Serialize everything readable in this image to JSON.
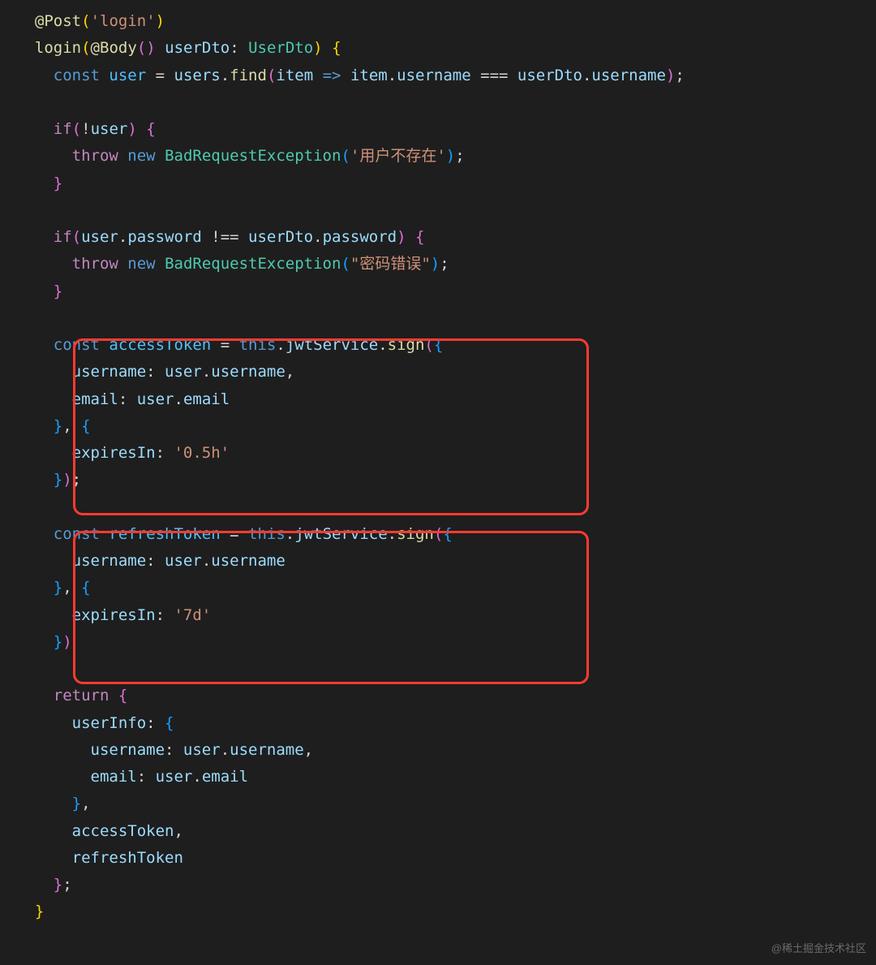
{
  "code": {
    "lines": [
      {
        "tokens": [
          {
            "t": "  ",
            "c": "punct"
          },
          {
            "t": "@",
            "c": "decorator"
          },
          {
            "t": "Post",
            "c": "function"
          },
          {
            "t": "(",
            "c": "bracket-yellow"
          },
          {
            "t": "'login'",
            "c": "string"
          },
          {
            "t": ")",
            "c": "bracket-yellow"
          }
        ]
      },
      {
        "tokens": [
          {
            "t": "  ",
            "c": "punct"
          },
          {
            "t": "login",
            "c": "function"
          },
          {
            "t": "(",
            "c": "bracket-yellow"
          },
          {
            "t": "@",
            "c": "decorator"
          },
          {
            "t": "Body",
            "c": "function"
          },
          {
            "t": "(",
            "c": "bracket-pink"
          },
          {
            "t": ")",
            "c": "bracket-pink"
          },
          {
            "t": " ",
            "c": "punct"
          },
          {
            "t": "userDto",
            "c": "param"
          },
          {
            "t": ": ",
            "c": "punct"
          },
          {
            "t": "UserDto",
            "c": "type"
          },
          {
            "t": ")",
            "c": "bracket-yellow"
          },
          {
            "t": " ",
            "c": "punct"
          },
          {
            "t": "{",
            "c": "bracket-yellow"
          }
        ]
      },
      {
        "tokens": [
          {
            "t": "    ",
            "c": "punct"
          },
          {
            "t": "const",
            "c": "keyword-blue"
          },
          {
            "t": " ",
            "c": "punct"
          },
          {
            "t": "user",
            "c": "variable2"
          },
          {
            "t": " = ",
            "c": "operator"
          },
          {
            "t": "users",
            "c": "variable"
          },
          {
            "t": ".",
            "c": "punct"
          },
          {
            "t": "find",
            "c": "function"
          },
          {
            "t": "(",
            "c": "bracket-pink"
          },
          {
            "t": "item",
            "c": "param"
          },
          {
            "t": " ",
            "c": "punct"
          },
          {
            "t": "=>",
            "c": "keyword-blue"
          },
          {
            "t": " ",
            "c": "punct"
          },
          {
            "t": "item",
            "c": "variable"
          },
          {
            "t": ".",
            "c": "punct"
          },
          {
            "t": "username",
            "c": "property"
          },
          {
            "t": " === ",
            "c": "operator"
          },
          {
            "t": "userDto",
            "c": "variable"
          },
          {
            "t": ".",
            "c": "punct"
          },
          {
            "t": "username",
            "c": "property"
          },
          {
            "t": ")",
            "c": "bracket-pink"
          },
          {
            "t": ";",
            "c": "punct"
          }
        ]
      },
      {
        "tokens": [
          {
            "t": " ",
            "c": "punct"
          }
        ]
      },
      {
        "tokens": [
          {
            "t": "    ",
            "c": "punct"
          },
          {
            "t": "if",
            "c": "keyword"
          },
          {
            "t": "(",
            "c": "bracket-pink"
          },
          {
            "t": "!",
            "c": "operator"
          },
          {
            "t": "user",
            "c": "variable"
          },
          {
            "t": ")",
            "c": "bracket-pink"
          },
          {
            "t": " ",
            "c": "punct"
          },
          {
            "t": "{",
            "c": "bracket-pink"
          }
        ]
      },
      {
        "tokens": [
          {
            "t": "      ",
            "c": "punct"
          },
          {
            "t": "throw",
            "c": "keyword"
          },
          {
            "t": " ",
            "c": "punct"
          },
          {
            "t": "new",
            "c": "new"
          },
          {
            "t": " ",
            "c": "punct"
          },
          {
            "t": "BadRequestException",
            "c": "type"
          },
          {
            "t": "(",
            "c": "bracket-blue"
          },
          {
            "t": "'用户不存在'",
            "c": "string"
          },
          {
            "t": ")",
            "c": "bracket-blue"
          },
          {
            "t": ";",
            "c": "punct"
          }
        ]
      },
      {
        "tokens": [
          {
            "t": "    ",
            "c": "punct"
          },
          {
            "t": "}",
            "c": "bracket-pink"
          }
        ]
      },
      {
        "tokens": [
          {
            "t": " ",
            "c": "punct"
          }
        ]
      },
      {
        "tokens": [
          {
            "t": "    ",
            "c": "punct"
          },
          {
            "t": "if",
            "c": "keyword"
          },
          {
            "t": "(",
            "c": "bracket-pink"
          },
          {
            "t": "user",
            "c": "variable"
          },
          {
            "t": ".",
            "c": "punct"
          },
          {
            "t": "password",
            "c": "property"
          },
          {
            "t": " !== ",
            "c": "operator"
          },
          {
            "t": "userDto",
            "c": "variable"
          },
          {
            "t": ".",
            "c": "punct"
          },
          {
            "t": "password",
            "c": "property"
          },
          {
            "t": ")",
            "c": "bracket-pink"
          },
          {
            "t": " ",
            "c": "punct"
          },
          {
            "t": "{",
            "c": "bracket-pink"
          }
        ]
      },
      {
        "tokens": [
          {
            "t": "      ",
            "c": "punct"
          },
          {
            "t": "throw",
            "c": "keyword"
          },
          {
            "t": " ",
            "c": "punct"
          },
          {
            "t": "new",
            "c": "new"
          },
          {
            "t": " ",
            "c": "punct"
          },
          {
            "t": "BadRequestException",
            "c": "type"
          },
          {
            "t": "(",
            "c": "bracket-blue"
          },
          {
            "t": "\"密码错误\"",
            "c": "string"
          },
          {
            "t": ")",
            "c": "bracket-blue"
          },
          {
            "t": ";",
            "c": "punct"
          }
        ]
      },
      {
        "tokens": [
          {
            "t": "    ",
            "c": "punct"
          },
          {
            "t": "}",
            "c": "bracket-pink"
          }
        ]
      },
      {
        "tokens": [
          {
            "t": " ",
            "c": "punct"
          }
        ]
      },
      {
        "tokens": [
          {
            "t": "    ",
            "c": "punct"
          },
          {
            "t": "const",
            "c": "keyword-blue"
          },
          {
            "t": " ",
            "c": "punct"
          },
          {
            "t": "accessToken",
            "c": "variable2"
          },
          {
            "t": " = ",
            "c": "operator"
          },
          {
            "t": "this",
            "c": "this"
          },
          {
            "t": ".",
            "c": "punct"
          },
          {
            "t": "jwtService",
            "c": "property"
          },
          {
            "t": ".",
            "c": "punct"
          },
          {
            "t": "sign",
            "c": "function"
          },
          {
            "t": "(",
            "c": "bracket-pink"
          },
          {
            "t": "{",
            "c": "bracket-blue"
          }
        ]
      },
      {
        "tokens": [
          {
            "t": "      ",
            "c": "punct"
          },
          {
            "t": "username",
            "c": "property"
          },
          {
            "t": ": ",
            "c": "punct"
          },
          {
            "t": "user",
            "c": "variable"
          },
          {
            "t": ".",
            "c": "punct"
          },
          {
            "t": "username",
            "c": "property"
          },
          {
            "t": ",",
            "c": "punct"
          }
        ]
      },
      {
        "tokens": [
          {
            "t": "      ",
            "c": "punct"
          },
          {
            "t": "email",
            "c": "property"
          },
          {
            "t": ": ",
            "c": "punct"
          },
          {
            "t": "user",
            "c": "variable"
          },
          {
            "t": ".",
            "c": "punct"
          },
          {
            "t": "email",
            "c": "property"
          }
        ]
      },
      {
        "tokens": [
          {
            "t": "    ",
            "c": "punct"
          },
          {
            "t": "}",
            "c": "bracket-blue"
          },
          {
            "t": ", ",
            "c": "punct"
          },
          {
            "t": "{",
            "c": "bracket-blue"
          }
        ]
      },
      {
        "tokens": [
          {
            "t": "      ",
            "c": "punct"
          },
          {
            "t": "expiresIn",
            "c": "property"
          },
          {
            "t": ": ",
            "c": "punct"
          },
          {
            "t": "'0.5h'",
            "c": "string"
          }
        ]
      },
      {
        "tokens": [
          {
            "t": "    ",
            "c": "punct"
          },
          {
            "t": "}",
            "c": "bracket-blue"
          },
          {
            "t": ")",
            "c": "bracket-pink"
          },
          {
            "t": ";",
            "c": "punct"
          }
        ]
      },
      {
        "tokens": [
          {
            "t": " ",
            "c": "punct"
          }
        ]
      },
      {
        "tokens": [
          {
            "t": "    ",
            "c": "punct"
          },
          {
            "t": "const",
            "c": "keyword-blue"
          },
          {
            "t": " ",
            "c": "punct"
          },
          {
            "t": "refreshToken",
            "c": "variable2"
          },
          {
            "t": " = ",
            "c": "operator"
          },
          {
            "t": "this",
            "c": "this"
          },
          {
            "t": ".",
            "c": "punct"
          },
          {
            "t": "jwtService",
            "c": "property"
          },
          {
            "t": ".",
            "c": "punct"
          },
          {
            "t": "sign",
            "c": "function"
          },
          {
            "t": "(",
            "c": "bracket-pink"
          },
          {
            "t": "{",
            "c": "bracket-blue"
          }
        ]
      },
      {
        "tokens": [
          {
            "t": "      ",
            "c": "punct"
          },
          {
            "t": "username",
            "c": "property"
          },
          {
            "t": ": ",
            "c": "punct"
          },
          {
            "t": "user",
            "c": "variable"
          },
          {
            "t": ".",
            "c": "punct"
          },
          {
            "t": "username",
            "c": "property"
          }
        ]
      },
      {
        "tokens": [
          {
            "t": "    ",
            "c": "punct"
          },
          {
            "t": "}",
            "c": "bracket-blue"
          },
          {
            "t": ", ",
            "c": "punct"
          },
          {
            "t": "{",
            "c": "bracket-blue"
          }
        ]
      },
      {
        "tokens": [
          {
            "t": "      ",
            "c": "punct"
          },
          {
            "t": "expiresIn",
            "c": "property"
          },
          {
            "t": ": ",
            "c": "punct"
          },
          {
            "t": "'7d'",
            "c": "string"
          }
        ]
      },
      {
        "tokens": [
          {
            "t": "    ",
            "c": "punct"
          },
          {
            "t": "}",
            "c": "bracket-blue"
          },
          {
            "t": ")",
            "c": "bracket-pink"
          }
        ]
      },
      {
        "tokens": [
          {
            "t": " ",
            "c": "punct"
          }
        ]
      },
      {
        "tokens": [
          {
            "t": "    ",
            "c": "punct"
          },
          {
            "t": "return",
            "c": "keyword"
          },
          {
            "t": " ",
            "c": "punct"
          },
          {
            "t": "{",
            "c": "bracket-pink"
          }
        ]
      },
      {
        "tokens": [
          {
            "t": "      ",
            "c": "punct"
          },
          {
            "t": "userInfo",
            "c": "property"
          },
          {
            "t": ": ",
            "c": "punct"
          },
          {
            "t": "{",
            "c": "bracket-blue"
          }
        ]
      },
      {
        "tokens": [
          {
            "t": "        ",
            "c": "punct"
          },
          {
            "t": "username",
            "c": "property"
          },
          {
            "t": ": ",
            "c": "punct"
          },
          {
            "t": "user",
            "c": "variable"
          },
          {
            "t": ".",
            "c": "punct"
          },
          {
            "t": "username",
            "c": "property"
          },
          {
            "t": ",",
            "c": "punct"
          }
        ]
      },
      {
        "tokens": [
          {
            "t": "        ",
            "c": "punct"
          },
          {
            "t": "email",
            "c": "property"
          },
          {
            "t": ": ",
            "c": "punct"
          },
          {
            "t": "user",
            "c": "variable"
          },
          {
            "t": ".",
            "c": "punct"
          },
          {
            "t": "email",
            "c": "property"
          }
        ]
      },
      {
        "tokens": [
          {
            "t": "      ",
            "c": "punct"
          },
          {
            "t": "}",
            "c": "bracket-blue"
          },
          {
            "t": ",",
            "c": "punct"
          }
        ]
      },
      {
        "tokens": [
          {
            "t": "      ",
            "c": "punct"
          },
          {
            "t": "accessToken",
            "c": "variable"
          },
          {
            "t": ",",
            "c": "punct"
          }
        ]
      },
      {
        "tokens": [
          {
            "t": "      ",
            "c": "punct"
          },
          {
            "t": "refreshToken",
            "c": "variable"
          }
        ]
      },
      {
        "tokens": [
          {
            "t": "    ",
            "c": "punct"
          },
          {
            "t": "}",
            "c": "bracket-pink"
          },
          {
            "t": ";",
            "c": "punct"
          }
        ]
      },
      {
        "tokens": [
          {
            "t": "  ",
            "c": "punct"
          },
          {
            "t": "}",
            "c": "bracket-yellow"
          }
        ]
      }
    ]
  },
  "watermark": "@稀土掘金技术社区",
  "highlights": [
    {
      "name": "access-token-block"
    },
    {
      "name": "refresh-token-block"
    }
  ]
}
